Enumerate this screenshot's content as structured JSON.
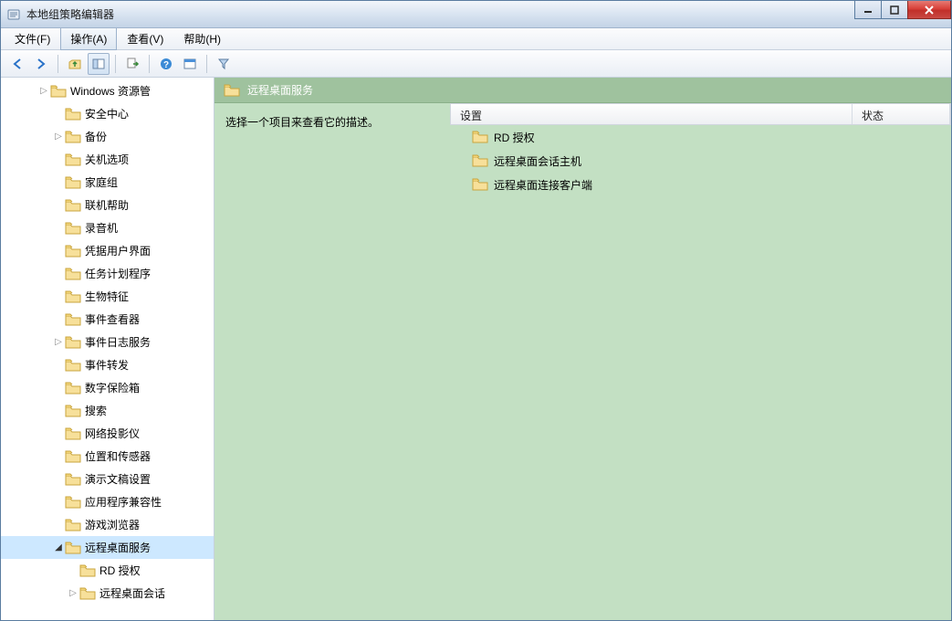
{
  "window": {
    "title": "本地组策略编辑器"
  },
  "menu": {
    "file": "文件(F)",
    "action": "操作(A)",
    "view": "查看(V)",
    "help": "帮助(H)"
  },
  "tree": {
    "items": [
      {
        "label": "Windows 资源管",
        "depth": 2,
        "expander": "right",
        "selectedTop": true
      },
      {
        "label": "安全中心",
        "depth": 3,
        "expander": "none"
      },
      {
        "label": "备份",
        "depth": 3,
        "expander": "right"
      },
      {
        "label": "关机选项",
        "depth": 3,
        "expander": "none"
      },
      {
        "label": "家庭组",
        "depth": 3,
        "expander": "none"
      },
      {
        "label": "联机帮助",
        "depth": 3,
        "expander": "none"
      },
      {
        "label": "录音机",
        "depth": 3,
        "expander": "none"
      },
      {
        "label": "凭据用户界面",
        "depth": 3,
        "expander": "none"
      },
      {
        "label": "任务计划程序",
        "depth": 3,
        "expander": "none"
      },
      {
        "label": "生物特征",
        "depth": 3,
        "expander": "none"
      },
      {
        "label": "事件查看器",
        "depth": 3,
        "expander": "none"
      },
      {
        "label": "事件日志服务",
        "depth": 3,
        "expander": "right"
      },
      {
        "label": "事件转发",
        "depth": 3,
        "expander": "none"
      },
      {
        "label": "数字保险箱",
        "depth": 3,
        "expander": "none"
      },
      {
        "label": "搜索",
        "depth": 3,
        "expander": "none"
      },
      {
        "label": "网络投影仪",
        "depth": 3,
        "expander": "none"
      },
      {
        "label": "位置和传感器",
        "depth": 3,
        "expander": "none"
      },
      {
        "label": "演示文稿设置",
        "depth": 3,
        "expander": "none"
      },
      {
        "label": "应用程序兼容性",
        "depth": 3,
        "expander": "none"
      },
      {
        "label": "游戏浏览器",
        "depth": 3,
        "expander": "none"
      },
      {
        "label": "远程桌面服务",
        "depth": 3,
        "expander": "down",
        "selected": true
      },
      {
        "label": "RD 授权",
        "depth": 4,
        "expander": "none"
      },
      {
        "label": "远程桌面会话",
        "depth": 4,
        "expander": "right"
      }
    ],
    "scroll_indicator": "▲"
  },
  "content": {
    "header": "远程桌面服务",
    "description": "选择一个项目来查看它的描述。",
    "columns": {
      "settings": "设置",
      "status": "状态"
    },
    "rows": [
      {
        "label": "RD 授权"
      },
      {
        "label": "远程桌面会话主机"
      },
      {
        "label": "远程桌面连接客户端"
      }
    ]
  }
}
